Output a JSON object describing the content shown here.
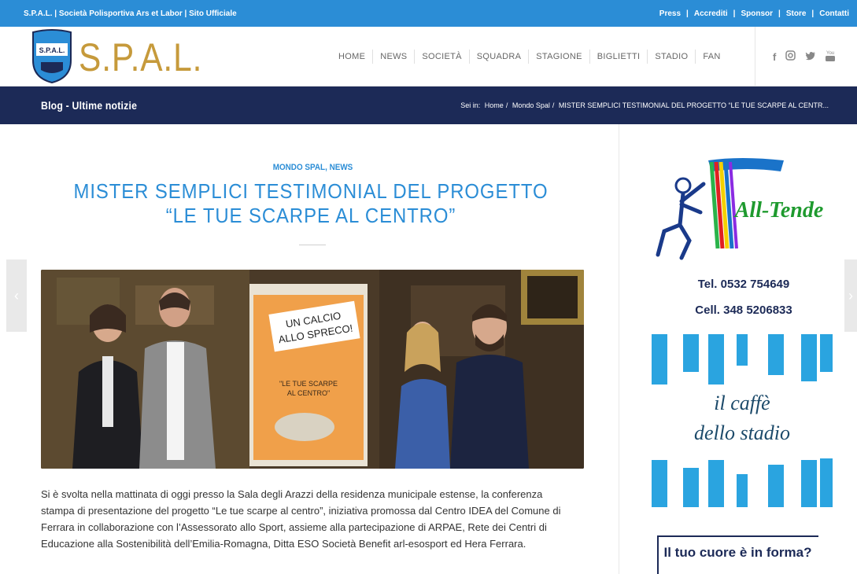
{
  "topbar": {
    "site_name": "S.P.A.L. | Società Polisportiva Ars et Labor | Sito Ufficiale",
    "links": [
      "Press",
      "Accrediti",
      "Sponsor",
      "Store",
      "Contatti"
    ]
  },
  "header": {
    "logo_text": "S.P.A.L.",
    "crest_text": "S.P.A.L.",
    "nav": [
      "HOME",
      "NEWS",
      "SOCIETÀ",
      "SQUADRA",
      "STAGIONE",
      "BIGLIETTI",
      "STADIO",
      "FAN"
    ],
    "social_icons": [
      "facebook-icon",
      "instagram-icon",
      "twitter-icon",
      "youtube-icon"
    ]
  },
  "titlebar": {
    "title": "Blog - Ultime notizie",
    "breadcrumb_prefix": "Sei in:",
    "breadcrumb": [
      "Home",
      "Mondo Spal",
      "MISTER SEMPLICI TESTIMONIAL DEL PROGETTO “LE TUE SCARPE AL CENTR..."
    ]
  },
  "post": {
    "categories": "MONDO SPAL, NEWS",
    "title": "MISTER SEMPLICI TESTIMONIAL DEL PROGETTO “LE TUE SCARPE AL CENTRO”",
    "poster_line1": "UN CALCIO",
    "poster_line2": "ALLO SPRECO!",
    "poster_line3": "\"LE TUE SCARPE",
    "poster_line4": "AL CENTRO\"",
    "body": "Si è svolta nella mattinata di oggi presso la Sala degli Arazzi della residenza municipale estense, la conferenza stampa di presentazione del progetto “Le tue scarpe al centro”, iniziativa promossa  dal Centro IDEA del Comune di Ferrara in collaborazione con l’Assessorato allo Sport, assieme alla partecipazione di ARPAE, Rete dei Centri di Educazione alla Sostenibilità dell’Emilia-Romagna, Ditta ESO Società Benefit arl-esosport ed Hera Ferrara."
  },
  "sidebar": {
    "ad1_brand": "All-Tende",
    "ad1_tel": "Tel. 0532 754649",
    "ad1_cell": "Cell. 348 5206833",
    "ad2_line1": "il caffè",
    "ad2_line2": "dello stadio",
    "ad3_text": "Il tuo cuore è in forma?"
  },
  "colors": {
    "accent": "#2b8dd6",
    "navy": "#1c2a57",
    "gold": "#c69a3b"
  }
}
